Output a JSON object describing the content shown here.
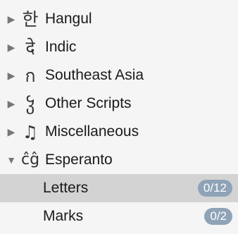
{
  "categories": [
    {
      "icon": "한",
      "icon_name": "hangul-glyph-icon",
      "label": "Hangul",
      "expanded": false
    },
    {
      "icon": "दे",
      "icon_name": "devanagari-glyph-icon",
      "label": "Indic",
      "expanded": false
    },
    {
      "icon": "ก",
      "icon_name": "thai-glyph-icon",
      "label": "Southeast Asia",
      "expanded": false
    },
    {
      "icon": "ჴ",
      "icon_name": "georgian-glyph-icon",
      "label": "Other Scripts",
      "expanded": false
    },
    {
      "icon": "♫",
      "icon_name": "music-note-icon",
      "label": "Miscellaneous",
      "expanded": false
    },
    {
      "icon": "ĉĝ",
      "icon_name": "esperanto-glyph-icon",
      "label": "Esperanto",
      "expanded": true
    }
  ],
  "subitems": [
    {
      "label": "Letters",
      "badge": "0/12",
      "selected": true
    },
    {
      "label": "Marks",
      "badge": "0/2",
      "selected": false
    }
  ],
  "colors": {
    "selection": "#d3d3d3",
    "badge": "#8fa3b7",
    "background": "#f5f5f5"
  }
}
